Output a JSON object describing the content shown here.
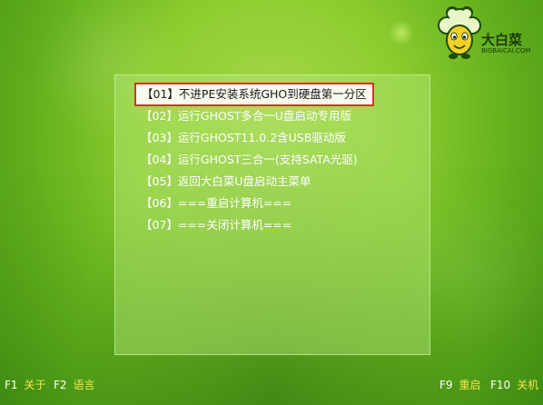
{
  "logo": {
    "title": "大白菜",
    "subtitle": "BIGBAICAI.COM",
    "icon": "cabbage-mascot-icon"
  },
  "menu": {
    "items": [
      {
        "label": "【01】不进PE安装系统GHO到硬盘第一分区",
        "selected": true
      },
      {
        "label": "【02】运行GHOST多合一U盘启动专用版",
        "selected": false
      },
      {
        "label": "【03】运行GHOST11.0.2含USB驱动版",
        "selected": false
      },
      {
        "label": "【04】运行GHOST三合一(支持SATA光驱)",
        "selected": false
      },
      {
        "label": "【05】返回大白菜U盘启动主菜单",
        "selected": false
      },
      {
        "label": "【06】===重启计算机===",
        "selected": false
      },
      {
        "label": "【07】===关闭计算机===",
        "selected": false
      }
    ]
  },
  "hotkeys": {
    "f1": {
      "key": "F1",
      "label": "关于"
    },
    "f2": {
      "key": "F2",
      "label": "语言"
    },
    "f9": {
      "key": "F9",
      "label": "重启"
    },
    "f10": {
      "key": "F10",
      "label": "关机"
    }
  },
  "colors": {
    "background": "#8ccc2e",
    "selection_border": "#e0301e",
    "hotkey_label": "#f4e64b",
    "menu_text": "#ffffff"
  }
}
